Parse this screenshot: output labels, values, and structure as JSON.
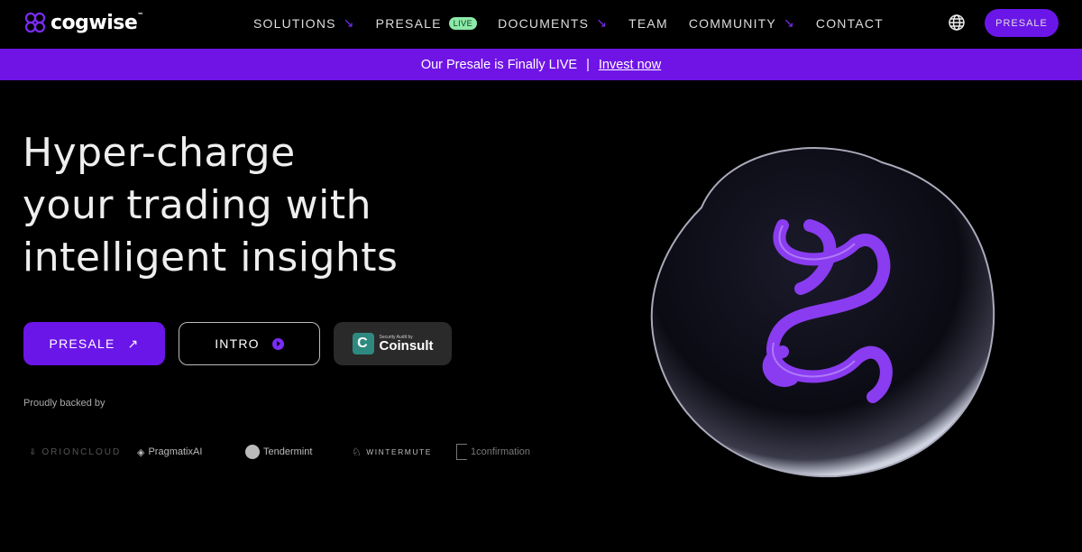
{
  "nav": {
    "logo": "cogwise",
    "trademark": "™",
    "items": [
      {
        "label": "SOLUTIONS",
        "arrow": true
      },
      {
        "label": "PRESALE",
        "badge": "LIVE"
      },
      {
        "label": "DOCUMENTS",
        "arrow": true
      },
      {
        "label": "TEAM"
      },
      {
        "label": "COMMUNITY",
        "arrow": true
      },
      {
        "label": "CONTACT"
      }
    ],
    "presale_button": "PRESALE",
    "icons": {
      "language": "globe-icon",
      "dropdown": "arrow-down-right-icon"
    }
  },
  "banner": {
    "text": "Our Presale is Finally LIVE",
    "separator": "|",
    "link": "Invest now"
  },
  "hero": {
    "title_lines": [
      "Hyper-charge",
      "your trading with",
      "intelligent insights"
    ],
    "presale_button": "PRESALE",
    "intro_button": "INTRO",
    "audit": {
      "small": "Security Audit by",
      "name": "Coinsult"
    },
    "backed_label": "Proudly backed by",
    "partners": [
      "ORIONCLOUD",
      "PragmatixAI",
      "Tendermint",
      "WINTERMUTE",
      "1confirmation"
    ]
  },
  "colors": {
    "accent": "#6b16e8",
    "banner": "#7014e6",
    "live_badge": "#8ce9a8"
  }
}
